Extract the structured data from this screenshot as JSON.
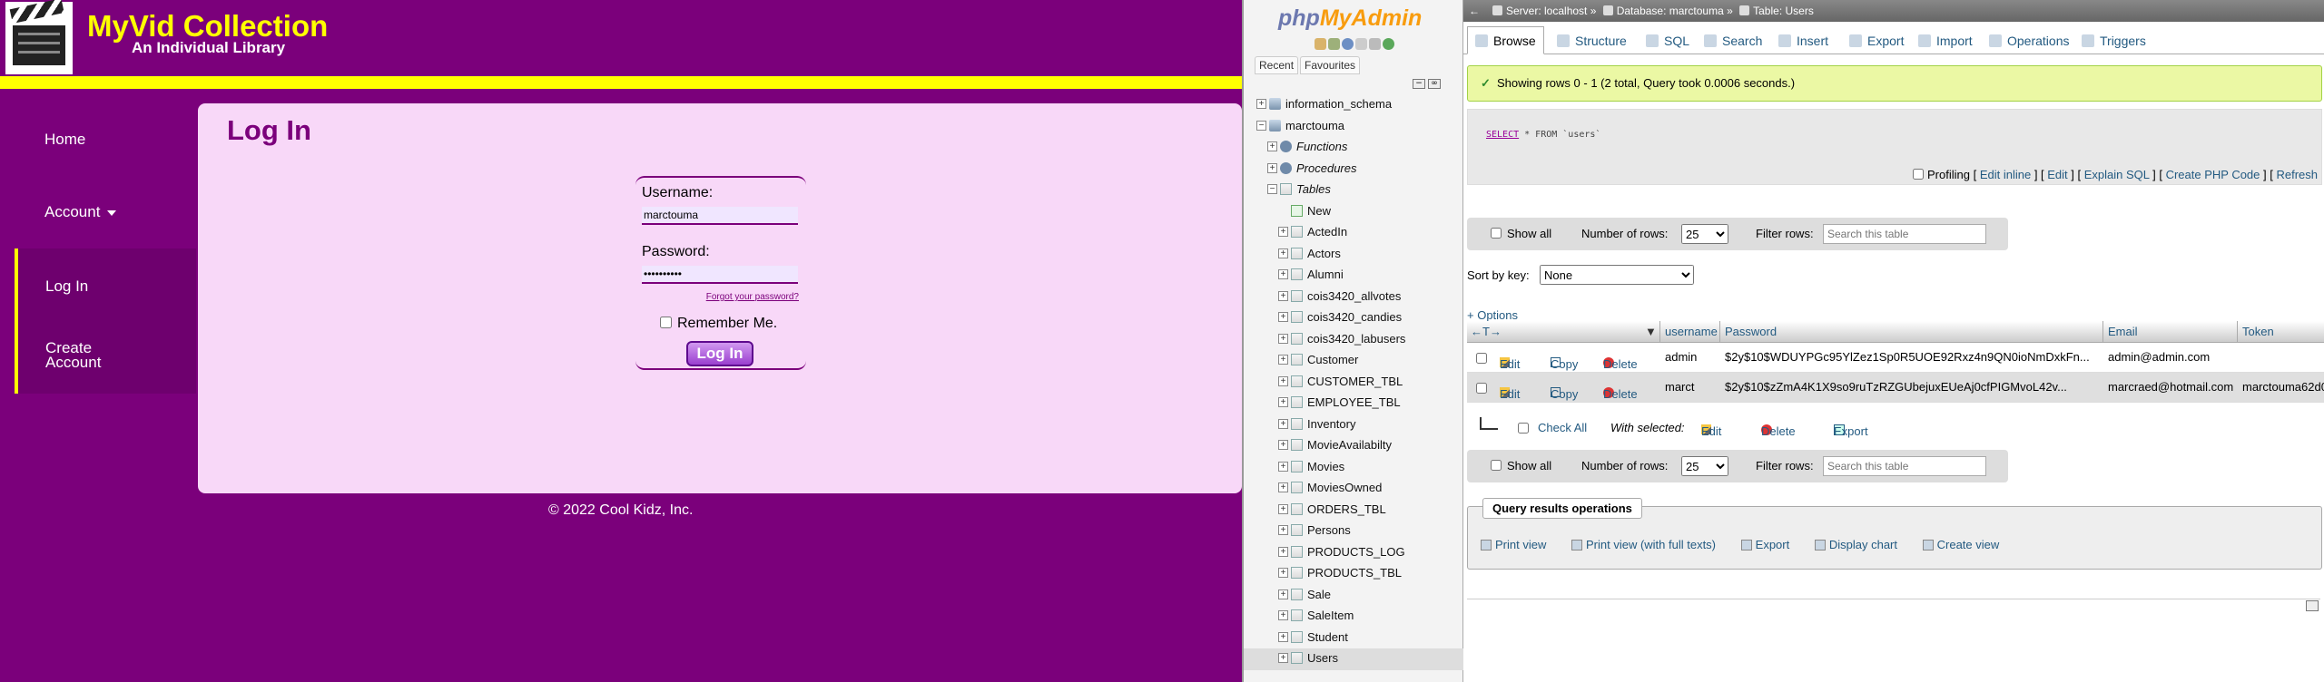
{
  "app": {
    "title": "MyVid Collection",
    "subtitle": "An Individual Library",
    "nav": {
      "home": "Home",
      "account": "Account",
      "login": "Log In",
      "create_account": "Create Account"
    },
    "page_title": "Log In",
    "form": {
      "username_label": "Username:",
      "username_value": "marctouma",
      "password_label": "Password:",
      "password_value": "••••••••••",
      "forgot": "Forgot your password?",
      "remember": "Remember Me.",
      "submit": "Log In"
    },
    "footer": "© 2022 Cool Kidz, Inc.",
    "colors": {
      "primary": "#7b007b",
      "accent": "#ffff00",
      "panel": "#f8d8f8"
    }
  },
  "pma_nav": {
    "logo_php": "php",
    "logo_main": "MyAdmin",
    "tabs": [
      "Recent",
      "Favourites"
    ],
    "tree": [
      {
        "label": "information_schema",
        "level": 0,
        "type": "db",
        "toggle": "+"
      },
      {
        "label": "marctouma",
        "level": 0,
        "type": "db",
        "toggle": "−"
      },
      {
        "label": "Functions",
        "level": 1,
        "type": "group",
        "toggle": "+"
      },
      {
        "label": "Procedures",
        "level": 1,
        "type": "group",
        "toggle": "+"
      },
      {
        "label": "Tables",
        "level": 1,
        "type": "group",
        "toggle": "−"
      },
      {
        "label": "New",
        "level": 2,
        "type": "new",
        "toggle": ""
      },
      {
        "label": "ActedIn",
        "level": 2,
        "type": "table",
        "toggle": "+"
      },
      {
        "label": "Actors",
        "level": 2,
        "type": "table",
        "toggle": "+"
      },
      {
        "label": "Alumni",
        "level": 2,
        "type": "table",
        "toggle": "+"
      },
      {
        "label": "cois3420_allvotes",
        "level": 2,
        "type": "table",
        "toggle": "+"
      },
      {
        "label": "cois3420_candies",
        "level": 2,
        "type": "table",
        "toggle": "+"
      },
      {
        "label": "cois3420_labusers",
        "level": 2,
        "type": "table",
        "toggle": "+"
      },
      {
        "label": "Customer",
        "level": 2,
        "type": "table",
        "toggle": "+"
      },
      {
        "label": "CUSTOMER_TBL",
        "level": 2,
        "type": "table",
        "toggle": "+"
      },
      {
        "label": "EMPLOYEE_TBL",
        "level": 2,
        "type": "table",
        "toggle": "+"
      },
      {
        "label": "Inventory",
        "level": 2,
        "type": "table",
        "toggle": "+"
      },
      {
        "label": "MovieAvailabilty",
        "level": 2,
        "type": "table",
        "toggle": "+"
      },
      {
        "label": "Movies",
        "level": 2,
        "type": "table",
        "toggle": "+"
      },
      {
        "label": "MoviesOwned",
        "level": 2,
        "type": "table",
        "toggle": "+"
      },
      {
        "label": "ORDERS_TBL",
        "level": 2,
        "type": "table",
        "toggle": "+"
      },
      {
        "label": "Persons",
        "level": 2,
        "type": "table",
        "toggle": "+"
      },
      {
        "label": "PRODUCTS_LOG",
        "level": 2,
        "type": "table",
        "toggle": "+"
      },
      {
        "label": "PRODUCTS_TBL",
        "level": 2,
        "type": "table",
        "toggle": "+"
      },
      {
        "label": "Sale",
        "level": 2,
        "type": "table",
        "toggle": "+"
      },
      {
        "label": "SaleItem",
        "level": 2,
        "type": "table",
        "toggle": "+"
      },
      {
        "label": "Student",
        "level": 2,
        "type": "table",
        "toggle": "+"
      },
      {
        "label": "Users",
        "level": 2,
        "type": "table",
        "toggle": "+",
        "selected": true
      }
    ]
  },
  "pma_main": {
    "breadcrumb": {
      "server": "Server: localhost",
      "database": "Database: marctouma",
      "table": "Table: Users"
    },
    "tabs": [
      "Browse",
      "Structure",
      "SQL",
      "Search",
      "Insert",
      "Export",
      "Import",
      "Operations",
      "Triggers"
    ],
    "success": "Showing rows 0 - 1 (2 total, Query took 0.0006 seconds.)",
    "sql": {
      "kw1": "SELECT",
      "rest": " * FROM `users`"
    },
    "sql_links": {
      "profiling": "Profiling",
      "edit_inline": "Edit inline",
      "edit": "Edit",
      "explain": "Explain SQL",
      "php": "Create PHP Code",
      "refresh": "Refresh"
    },
    "navbar": {
      "show_all": "Show all",
      "num_rows_label": "Number of rows:",
      "num_rows": "25",
      "filter_label": "Filter rows:",
      "filter_placeholder": "Search this table"
    },
    "sort_label": "Sort by key:",
    "sort_value": "None",
    "options": "+ Options",
    "columns": [
      "username",
      "Password",
      "Email",
      "Token"
    ],
    "row_actions": {
      "edit": "Edit",
      "copy": "Copy",
      "delete": "Delete"
    },
    "rows": [
      {
        "username": "admin",
        "password": "$2y$10$WDUYPGc95YlZez1Sp0R5UOE92Rxz4n9QN0ioNmDxkFn...",
        "email": "admin@admin.com",
        "token": ""
      },
      {
        "username": "marct",
        "password": "$2y$10$zZmA4K1X9so9ruTzRZGUbejuxEUeAj0cfPIGMvoL42v...",
        "email": "marcraed@hotmail.com",
        "token": "marctouma62d0"
      }
    ],
    "with_selected": {
      "check_all": "Check All",
      "label": "With selected:",
      "edit": "Edit",
      "delete": "Delete",
      "export": "Export"
    },
    "qro": {
      "legend": "Query results operations",
      "print": "Print view",
      "print_full": "Print view (with full texts)",
      "export": "Export",
      "chart": "Display chart",
      "view": "Create view"
    }
  }
}
